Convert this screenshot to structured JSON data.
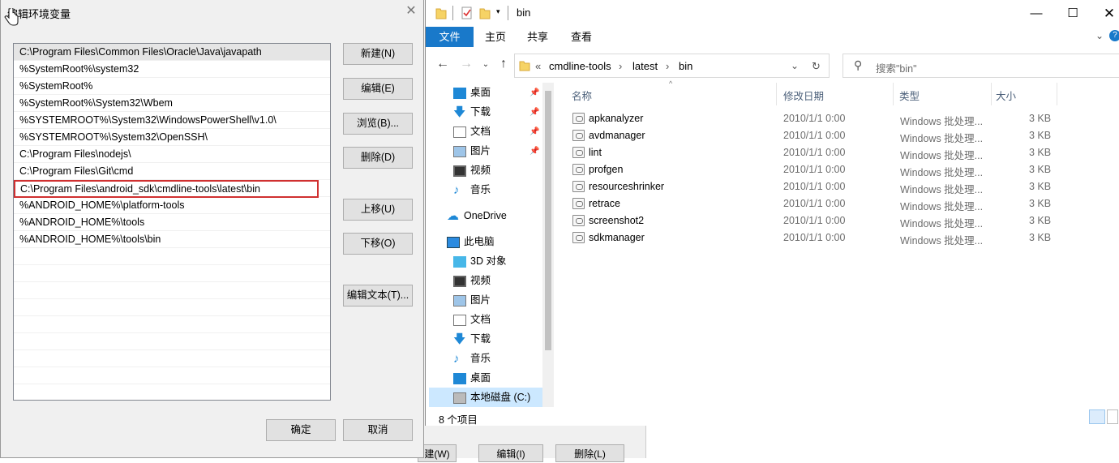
{
  "dialog": {
    "title": "编辑环境变量",
    "paths": [
      "C:\\Program Files\\Common Files\\Oracle\\Java\\javapath",
      "%SystemRoot%\\system32",
      "%SystemRoot%",
      "%SystemRoot%\\System32\\Wbem",
      "%SYSTEMROOT%\\System32\\WindowsPowerShell\\v1.0\\",
      "%SYSTEMROOT%\\System32\\OpenSSH\\",
      "C:\\Program Files\\nodejs\\",
      "C:\\Program Files\\Git\\cmd",
      "C:\\Program Files\\android_sdk\\cmdline-tools\\latest\\bin",
      "%ANDROID_HOME%\\platform-tools",
      "%ANDROID_HOME%\\tools",
      "%ANDROID_HOME%\\tools\\bin"
    ],
    "buttons": {
      "new": "新建(N)",
      "edit": "编辑(E)",
      "browse": "浏览(B)...",
      "delete": "删除(D)",
      "move_up": "上移(U)",
      "move_down": "下移(O)",
      "edit_text": "编辑文本(T)...",
      "ok": "确定",
      "cancel": "取消"
    }
  },
  "background": {
    "btn1": "建(W)",
    "btn2": "编辑(I)",
    "btn3": "删除(L)"
  },
  "explorer": {
    "title": "bin",
    "ribbon_tabs": [
      "文件",
      "主页",
      "共享",
      "查看"
    ],
    "breadcrumb": [
      "«",
      "cmdline-tools",
      "latest",
      "bin"
    ],
    "search_placeholder": "搜索\"bin\"",
    "nav": {
      "quick": [
        "桌面",
        "下载",
        "文档",
        "图片",
        "视频",
        "音乐"
      ],
      "onedrive": "OneDrive",
      "this_pc": "此电脑",
      "pc_items": [
        "3D 对象",
        "视频",
        "图片",
        "文档",
        "下载",
        "音乐",
        "桌面",
        "本地磁盘 (C:)"
      ]
    },
    "columns": {
      "name": "名称",
      "date": "修改日期",
      "type": "类型",
      "size": "大小"
    },
    "files": [
      {
        "name": "apkanalyzer",
        "date": "2010/1/1 0:00",
        "type": "Windows 批处理...",
        "size": "3 KB"
      },
      {
        "name": "avdmanager",
        "date": "2010/1/1 0:00",
        "type": "Windows 批处理...",
        "size": "3 KB"
      },
      {
        "name": "lint",
        "date": "2010/1/1 0:00",
        "type": "Windows 批处理...",
        "size": "3 KB"
      },
      {
        "name": "profgen",
        "date": "2010/1/1 0:00",
        "type": "Windows 批处理...",
        "size": "3 KB"
      },
      {
        "name": "resourceshrinker",
        "date": "2010/1/1 0:00",
        "type": "Windows 批处理...",
        "size": "3 KB"
      },
      {
        "name": "retrace",
        "date": "2010/1/1 0:00",
        "type": "Windows 批处理...",
        "size": "3 KB"
      },
      {
        "name": "screenshot2",
        "date": "2010/1/1 0:00",
        "type": "Windows 批处理...",
        "size": "3 KB"
      },
      {
        "name": "sdkmanager",
        "date": "2010/1/1 0:00",
        "type": "Windows 批处理...",
        "size": "3 KB"
      }
    ],
    "status": "8 个项目",
    "colors": {
      "accent": "#1979ca",
      "selection": "#cce8ff"
    }
  }
}
